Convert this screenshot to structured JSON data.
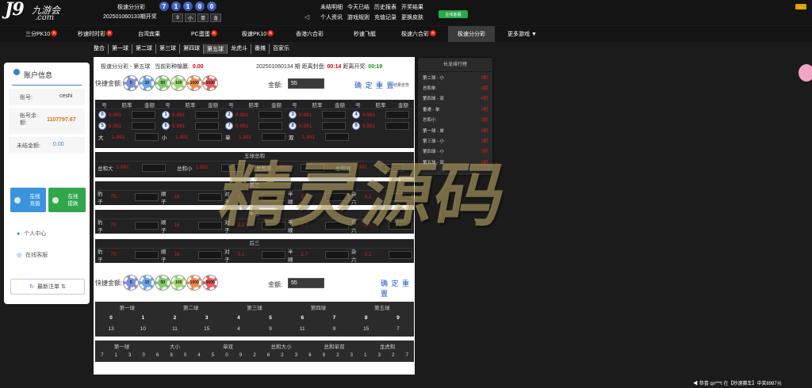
{
  "header": {
    "logo_text": "J9",
    "logo_cn": "九游会",
    "logo_com": ".com",
    "lottery_name": "极速分分彩",
    "period": "202501060133期开奖",
    "result_balls": [
      "7",
      "1",
      "1",
      "0",
      "0"
    ],
    "result_stats": [
      "9",
      "小",
      "单",
      "龙"
    ],
    "menu": [
      "未结明细",
      "今天已结",
      "历史报表",
      "开奖结果",
      "个人资讯",
      "游戏规则",
      "充值记录",
      "更换皮肤"
    ],
    "cash_button": "在线客服",
    "corner_badge": "..."
  },
  "nav": {
    "items": [
      {
        "label": "三分PK10",
        "hot": true
      },
      {
        "label": "秒速时时彩",
        "hot": true
      },
      {
        "label": "台湾宾果",
        "hot": false
      },
      {
        "label": "PC蛋蛋",
        "hot": true
      },
      {
        "label": "极速PK10",
        "hot": true
      },
      {
        "label": "香港六合彩",
        "hot": false
      },
      {
        "label": "秒速飞艇",
        "hot": false
      },
      {
        "label": "极速六合彩",
        "hot": true
      },
      {
        "label": "极速分分彩",
        "hot": false
      },
      {
        "label": "更多游戏 ▼",
        "hot": false
      }
    ],
    "hot_label": "热",
    "active_index": 8
  },
  "subnav": {
    "items": [
      "整合",
      "第一球",
      "第二球",
      "第三球",
      "第四球",
      "第五球",
      "龙虎斗",
      "番摊",
      "百家乐"
    ],
    "active_index": 5
  },
  "account": {
    "title": "账户信息",
    "username_label": "账号:",
    "username": "ceshi",
    "balance_label": "帐号余额:",
    "balance": "1107797.67",
    "unsettled_label": "未结金额:",
    "unsettled": "0.00",
    "deposit_label": "在线充值",
    "withdraw_label": "在线提款",
    "personal_center": "个人中心",
    "online_service": "在线客服",
    "refresh_label": "最新注单"
  },
  "bet": {
    "game": "极速分分彩",
    "ball": "第五球",
    "loss_label": "当前彩种输赢:",
    "loss_value": "0.00",
    "current_period": "202501060134 期",
    "close_label": "距离封盘:",
    "close_time": "00:14",
    "open_label": "距离开奖:",
    "open_time": "00:19",
    "quick_amount_label": "快捷金额:",
    "chips": [
      {
        "value": "5",
        "color": "#7d8ed8"
      },
      {
        "value": "10",
        "color": "#6aa3e8"
      },
      {
        "value": "50",
        "color": "#7ec86c"
      },
      {
        "value": "100",
        "color": "#9ed86e"
      },
      {
        "value": "1000",
        "color": "#f08a4a"
      },
      {
        "value": "5000",
        "color": "#e85858"
      }
    ],
    "amount_label": "金额:",
    "amount_value": "55",
    "confirm": "确 定",
    "reset": "重 置",
    "trend_link": "结果走势"
  },
  "odds": {
    "headers": [
      "号",
      "赔率",
      "金额"
    ],
    "rows": [
      [
        {
          "num": "0",
          "odds": "9.991"
        },
        {
          "num": "1",
          "odds": "9.991"
        },
        {
          "num": "2",
          "odds": "9.991"
        },
        {
          "num": "3",
          "odds": "9.991"
        },
        {
          "num": "4",
          "odds": "9.991"
        }
      ],
      [
        {
          "num": "5",
          "odds": "9.991"
        },
        {
          "num": "6",
          "odds": "9.991"
        },
        {
          "num": "7",
          "odds": "9.991"
        },
        {
          "num": "8",
          "odds": "9.991"
        },
        {
          "num": "9",
          "odds": "9.991"
        }
      ],
      [
        {
          "num": "大",
          "odds": "1.991"
        },
        {
          "num": "小",
          "odds": "1.991"
        },
        {
          "num": "单",
          "odds": "1.991"
        },
        {
          "num": "双",
          "odds": "1.991"
        }
      ]
    ]
  },
  "total": {
    "title": "五球总和",
    "items": [
      {
        "label": "总和大",
        "odds": "1.991"
      },
      {
        "label": "总和小",
        "odds": "1.991"
      },
      {
        "label": "总和单",
        "odds": "1.991"
      },
      {
        "label": "总和双",
        "odds": "1.991"
      }
    ]
  },
  "sections": [
    {
      "title": "前三",
      "items": [
        {
          "label": "豹子",
          "odds": "75"
        },
        {
          "label": "顺子",
          "odds": "16"
        },
        {
          "label": "对子",
          "odds": "3.2"
        },
        {
          "label": "半顺",
          "odds": "2.2"
        },
        {
          "label": "杂六",
          "odds": "3.2"
        }
      ]
    },
    {
      "title": "中三",
      "items": [
        {
          "label": "豹子",
          "odds": "75"
        },
        {
          "label": "顺子",
          "odds": "16"
        },
        {
          "label": "对子",
          "odds": "3.2"
        },
        {
          "label": "半顺",
          "odds": "2.7"
        },
        {
          "label": "杂六",
          "odds": "3.2"
        }
      ]
    },
    {
      "title": "后三",
      "items": [
        {
          "label": "豹子",
          "odds": "75"
        },
        {
          "label": "顺子",
          "odds": "16"
        },
        {
          "label": "对子",
          "odds": "3.2"
        },
        {
          "label": "半顺",
          "odds": "2.7"
        },
        {
          "label": "杂六",
          "odds": "3.2"
        }
      ]
    }
  ],
  "stats": {
    "ball_headers": [
      "第一球",
      "第二球",
      "第三球",
      "第四球",
      "第五球"
    ],
    "numbers": [
      "0",
      "1",
      "2",
      "3",
      "4",
      "5",
      "6",
      "7",
      "8",
      "9"
    ],
    "counts": [
      "13",
      "10",
      "11",
      "15",
      "4",
      "9",
      "11",
      "9",
      "15",
      "7"
    ],
    "headers2": [
      "第一球",
      "大小",
      "单双",
      "总和大小",
      "总和单双",
      "龙虎和"
    ],
    "history": [
      "7",
      "1",
      "3",
      "0",
      "6",
      "8",
      "0",
      "4",
      "5",
      "0",
      "9",
      "2",
      "6",
      "2",
      "3",
      "6",
      "9",
      "2",
      "3",
      "1",
      "3",
      "2",
      "7"
    ]
  },
  "longdragon": {
    "title": "长龙排行榜",
    "items": [
      {
        "label": "第二球 - 小",
        "count": "3期"
      },
      {
        "label": "总和单",
        "count": "4期"
      },
      {
        "label": "第四球 - 双",
        "count": "4期"
      },
      {
        "label": "番滩 - 单",
        "count": "4期"
      },
      {
        "label": "总和小",
        "count": "3期"
      },
      {
        "label": "第一球 - 单",
        "count": "3期"
      },
      {
        "label": "第三球 - 小",
        "count": "3期"
      },
      {
        "label": "第四球 - 小",
        "count": "3期"
      },
      {
        "label": "第五球 - 双",
        "count": "3期"
      }
    ]
  },
  "watermark": "精灵源码",
  "ticker": "恭喜 qn***t 在【秒速赛车】中奖8987元"
}
